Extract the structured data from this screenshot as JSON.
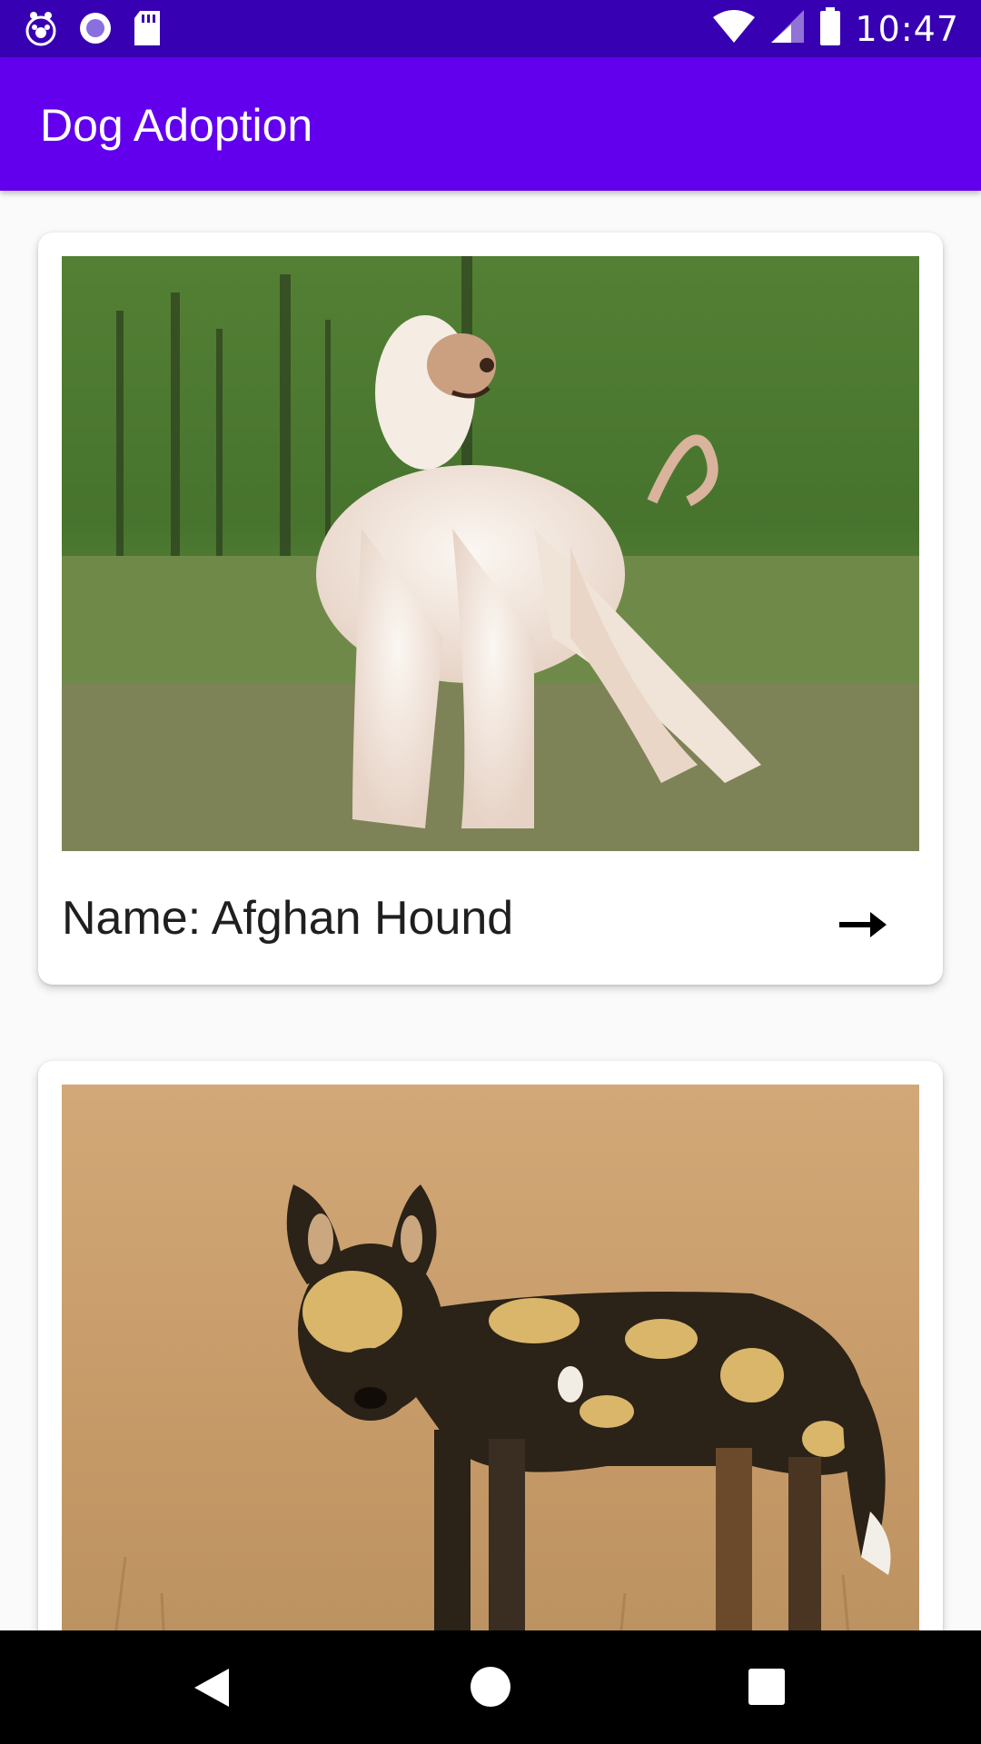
{
  "status_bar": {
    "time": "10:47",
    "icons": [
      "paw-notification-icon",
      "circle-notification-icon",
      "sd-card-icon",
      "wifi-icon",
      "cell-signal-icon",
      "battery-icon"
    ]
  },
  "app_bar": {
    "title": "Dog Adoption"
  },
  "dogs": [
    {
      "name_label": "Name: Afghan Hound",
      "photo": "afghan-hound-photo"
    },
    {
      "photo": "african-wild-dog-photo"
    }
  ],
  "navigation": {
    "icons": [
      "back-icon",
      "home-icon",
      "recents-icon"
    ]
  },
  "colors": {
    "status_bar": "#3700b3",
    "app_bar": "#6200ee",
    "background": "#fafafa"
  }
}
